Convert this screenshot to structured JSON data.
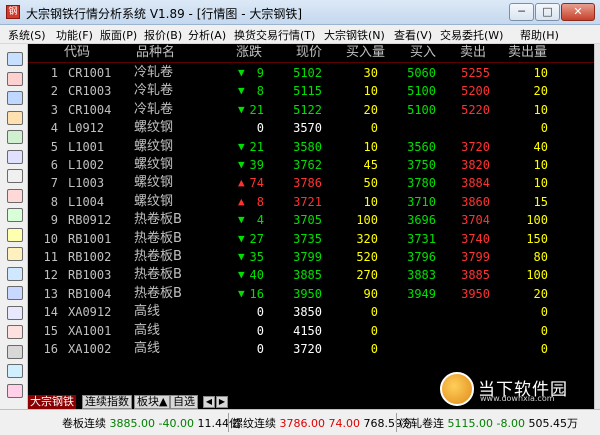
{
  "window": {
    "title": "大宗钢铁行情分析系统 V1.89 - [行情图 - 大宗钢铁]",
    "controls": [
      "─",
      "□",
      "✕"
    ]
  },
  "menu": [
    {
      "label": "系统(S)"
    },
    {
      "label": "功能(F)"
    },
    {
      "label": "版面(P)"
    },
    {
      "label": "报价(B)"
    },
    {
      "label": "分析(A)"
    },
    {
      "label": "换货交易行情(T)"
    },
    {
      "label": "大宗钢铁(N)"
    },
    {
      "label": "查看(V)"
    },
    {
      "label": "交易委托(W)"
    },
    {
      "label": "帮助(H)"
    }
  ],
  "toolbar_icons": [
    {
      "name": "exit-icon",
      "color": "#c8e0ff"
    },
    {
      "name": "download-icon",
      "color": "#ffd0d0"
    },
    {
      "name": "quote-table-icon",
      "color": "#c0d8ff"
    },
    {
      "name": "grid-icon",
      "color": "#ffe0b0"
    },
    {
      "name": "page-icon",
      "color": "#d0f0d0"
    },
    {
      "name": "search-doc-icon",
      "color": "#e0e0ff"
    },
    {
      "name": "line-chart-icon",
      "color": "#f0f0f0"
    },
    {
      "name": "candle-chart-icon",
      "color": "#ffd8d8"
    },
    {
      "name": "bar-chart-icon",
      "color": "#d8ffd8"
    },
    {
      "name": "note-icon",
      "color": "#ffffb0"
    },
    {
      "name": "memo-icon",
      "color": "#fff0c0"
    },
    {
      "name": "mail-icon",
      "color": "#d0e8ff"
    },
    {
      "name": "phone-icon",
      "color": "#c8d8ff"
    },
    {
      "name": "calendar-icon",
      "color": "#e8e8ff"
    },
    {
      "name": "draw-icon",
      "color": "#ffe0e0"
    },
    {
      "name": "tools-icon",
      "color": "#d8d8d8"
    },
    {
      "name": "info-icon",
      "color": "#d0f0ff"
    },
    {
      "name": "book-icon",
      "color": "#ffd0e8"
    }
  ],
  "columns": {
    "code": "代码",
    "name": "品种名",
    "change": "涨跌",
    "price": "现价",
    "bid_volume": "买入量",
    "bid": "买入",
    "ask": "卖出",
    "ask_volume": "卖出量"
  },
  "colors": {
    "up": "#ff3232",
    "down": "#00e000",
    "flat": "#ffffff",
    "volume": "#ffff00",
    "label": "#c0c0c0",
    "background": "#000000"
  },
  "rows": [
    {
      "idx": "1",
      "code": "CR1001",
      "name": "冷轧卷",
      "dir": "down",
      "change": "9",
      "price": "5102",
      "bid_volume": "30",
      "bid": "5060",
      "ask": "5255",
      "ask_volume": "10"
    },
    {
      "idx": "2",
      "code": "CR1003",
      "name": "冷轧卷",
      "dir": "down",
      "change": "8",
      "price": "5115",
      "bid_volume": "10",
      "bid": "5100",
      "ask": "5200",
      "ask_volume": "20"
    },
    {
      "idx": "3",
      "code": "CR1004",
      "name": "冷轧卷",
      "dir": "down",
      "change": "21",
      "price": "5122",
      "bid_volume": "20",
      "bid": "5100",
      "ask": "5220",
      "ask_volume": "10"
    },
    {
      "idx": "4",
      "code": "L0912",
      "name": "螺纹钢",
      "dir": "flat",
      "change": "0",
      "price": "3570",
      "bid_volume": "0",
      "bid": "",
      "ask": "",
      "ask_volume": "0"
    },
    {
      "idx": "5",
      "code": "L1001",
      "name": "螺纹钢",
      "dir": "down",
      "change": "21",
      "price": "3580",
      "bid_volume": "10",
      "bid": "3560",
      "ask": "3720",
      "ask_volume": "40"
    },
    {
      "idx": "6",
      "code": "L1002",
      "name": "螺纹钢",
      "dir": "down",
      "change": "39",
      "price": "3762",
      "bid_volume": "45",
      "bid": "3750",
      "ask": "3820",
      "ask_volume": "10"
    },
    {
      "idx": "7",
      "code": "L1003",
      "name": "螺纹钢",
      "dir": "up",
      "change": "74",
      "price": "3786",
      "bid_volume": "50",
      "bid": "3780",
      "ask": "3884",
      "ask_volume": "10"
    },
    {
      "idx": "8",
      "code": "L1004",
      "name": "螺纹钢",
      "dir": "up",
      "change": "8",
      "price": "3721",
      "bid_volume": "10",
      "bid": "3710",
      "ask": "3860",
      "ask_volume": "15"
    },
    {
      "idx": "9",
      "code": "RB0912",
      "name": "热卷板B",
      "dir": "down",
      "change": "4",
      "price": "3705",
      "bid_volume": "100",
      "bid": "3696",
      "ask": "3704",
      "ask_volume": "100"
    },
    {
      "idx": "10",
      "code": "RB1001",
      "name": "热卷板B",
      "dir": "down",
      "change": "27",
      "price": "3735",
      "bid_volume": "320",
      "bid": "3731",
      "ask": "3740",
      "ask_volume": "150"
    },
    {
      "idx": "11",
      "code": "RB1002",
      "name": "热卷板B",
      "dir": "down",
      "change": "35",
      "price": "3799",
      "bid_volume": "520",
      "bid": "3796",
      "ask": "3799",
      "ask_volume": "80"
    },
    {
      "idx": "12",
      "code": "RB1003",
      "name": "热卷板B",
      "dir": "down",
      "change": "40",
      "price": "3885",
      "bid_volume": "270",
      "bid": "3883",
      "ask": "3885",
      "ask_volume": "100"
    },
    {
      "idx": "13",
      "code": "RB1004",
      "name": "热卷板B",
      "dir": "down",
      "change": "16",
      "price": "3950",
      "bid_volume": "90",
      "bid": "3949",
      "ask": "3950",
      "ask_volume": "20"
    },
    {
      "idx": "14",
      "code": "XA0912",
      "name": "高线",
      "dir": "flat",
      "change": "0",
      "price": "3850",
      "bid_volume": "0",
      "bid": "",
      "ask": "",
      "ask_volume": "0"
    },
    {
      "idx": "15",
      "code": "XA1001",
      "name": "高线",
      "dir": "flat",
      "change": "0",
      "price": "4150",
      "bid_volume": "0",
      "bid": "",
      "ask": "",
      "ask_volume": "0"
    },
    {
      "idx": "16",
      "code": "XA1002",
      "name": "高线",
      "dir": "flat",
      "change": "0",
      "price": "3720",
      "bid_volume": "0",
      "bid": "",
      "ask": "",
      "ask_volume": "0"
    }
  ],
  "tabs": [
    {
      "label": "大宗钢铁",
      "active": true
    },
    {
      "label": "连续指数",
      "active": false
    },
    {
      "label": "板块▲",
      "active": false
    },
    {
      "label": "自选",
      "active": false
    }
  ],
  "tab_scroll": {
    "left": "◀",
    "right": "▶"
  },
  "status": [
    {
      "name": "卷板连续",
      "price": "3885.00",
      "change": "-40.00",
      "extra": "11.44亿",
      "color": "#008000"
    },
    {
      "name": "螺纹连续",
      "price": "3786.00",
      "change": "74.00",
      "extra": "768.59万",
      "color": "#e00000"
    },
    {
      "name": "冷轧卷连",
      "price": "5115.00",
      "change": "-8.00",
      "extra": "505.45万",
      "color": "#008000"
    }
  ],
  "watermark": {
    "text": "当下软件园",
    "sub": "www.downxia.com"
  }
}
